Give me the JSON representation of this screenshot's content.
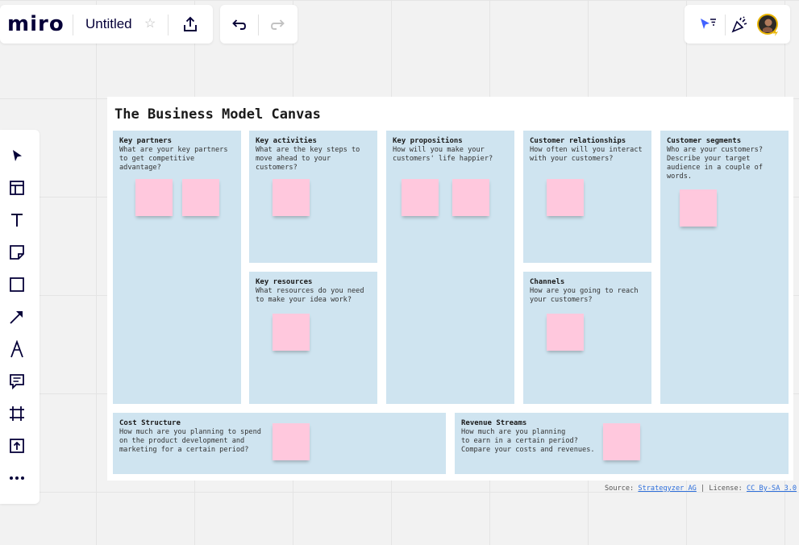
{
  "app": {
    "logo": "miro",
    "board_title": "Untitled"
  },
  "canvas": {
    "title": "The Business Model Canvas",
    "blocks": [
      {
        "title": "Key partners",
        "desc": "What are your key partners\nto get competitive\nadvantage?"
      },
      {
        "title": "Key activities",
        "desc": "What are the key steps to\nmove ahead to your\ncustomers?"
      },
      {
        "title": "Key resources",
        "desc": "What resources do you need\nto make your idea work?"
      },
      {
        "title": "Key propositions",
        "desc": "How will you make your\ncustomers' life happier?"
      },
      {
        "title": "Customer relationships",
        "desc": "How often will you interact\nwith your customers?"
      },
      {
        "title": "Channels",
        "desc": "How are you going to reach\nyour customers?"
      },
      {
        "title": "Customer segments",
        "desc": "Who are your customers?\nDescribe your target\naudience in a couple of\nwords."
      },
      {
        "title": "Cost Structure",
        "desc": "How much are you planning to spend\non the product development and\nmarketing for a certain period?"
      },
      {
        "title": "Revenue Streams",
        "desc": "How much are you planning\nto earn in a certain period?\nCompare your costs and revenues."
      }
    ],
    "footer": {
      "source_label": "Source:",
      "source_link": "Strategyzer AG",
      "sep": "|",
      "license_label": "License:",
      "license_link": "CC By-SA 3.0"
    }
  },
  "colors": {
    "block_bg": "#cfe4f0",
    "sticky": "#ffc8dd",
    "accent": "#4262ff",
    "brand": "#050038"
  }
}
